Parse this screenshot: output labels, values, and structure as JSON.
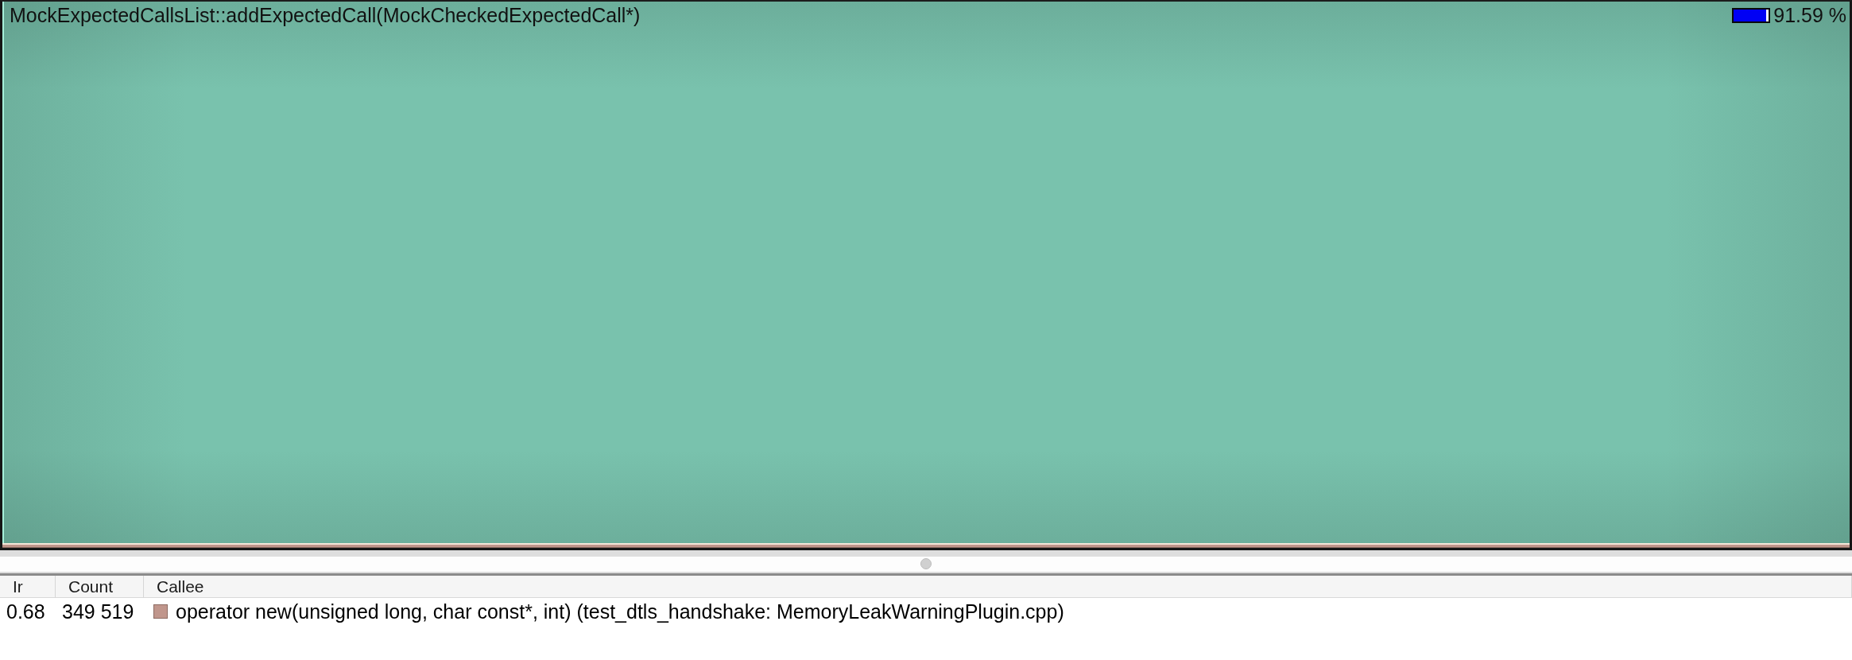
{
  "treemap": {
    "title": "MockExpectedCallsList::addExpectedCall(MockCheckedExpectedCall*)",
    "cost_bar": {
      "level": 0.9159
    },
    "percentage": "91.59 %"
  },
  "callee_list": {
    "columns": [
      "Ir",
      "Count",
      "Callee"
    ],
    "rows": [
      {
        "ir": "0.68",
        "count": "349 519",
        "callee": "operator new(unsigned long, char const*, int) (test_dtls_handshake: MemoryLeakWarningPlugin.cpp)",
        "color": "#c0968c"
      }
    ]
  }
}
